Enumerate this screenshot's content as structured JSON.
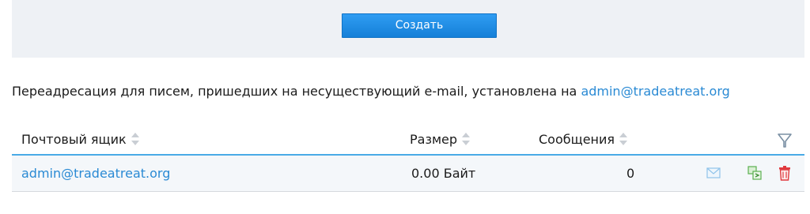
{
  "create_button": {
    "label": "Создать"
  },
  "info": {
    "text": "Переадресация для писем, пришедших на несуществующий e-mail, установлена на ",
    "email": "admin@tradeatreat.org"
  },
  "table": {
    "columns": {
      "mailbox": "Почтовый ящик",
      "size": "Размер",
      "messages": "Сообщения"
    },
    "rows": [
      {
        "mailbox": "admin@tradeatreat.org",
        "size": "0.00 Байт",
        "messages": "0"
      }
    ]
  },
  "icons": {
    "sort": "sort-icon",
    "filter": "filter-icon",
    "mail": "mail-icon",
    "forward": "forward-icon",
    "delete": "trash-icon"
  },
  "colors": {
    "accent": "#1580d8",
    "link": "#2a8ad4",
    "header_line": "#49aae6",
    "delete": "#e0393e",
    "forward": "#5ab04f"
  }
}
